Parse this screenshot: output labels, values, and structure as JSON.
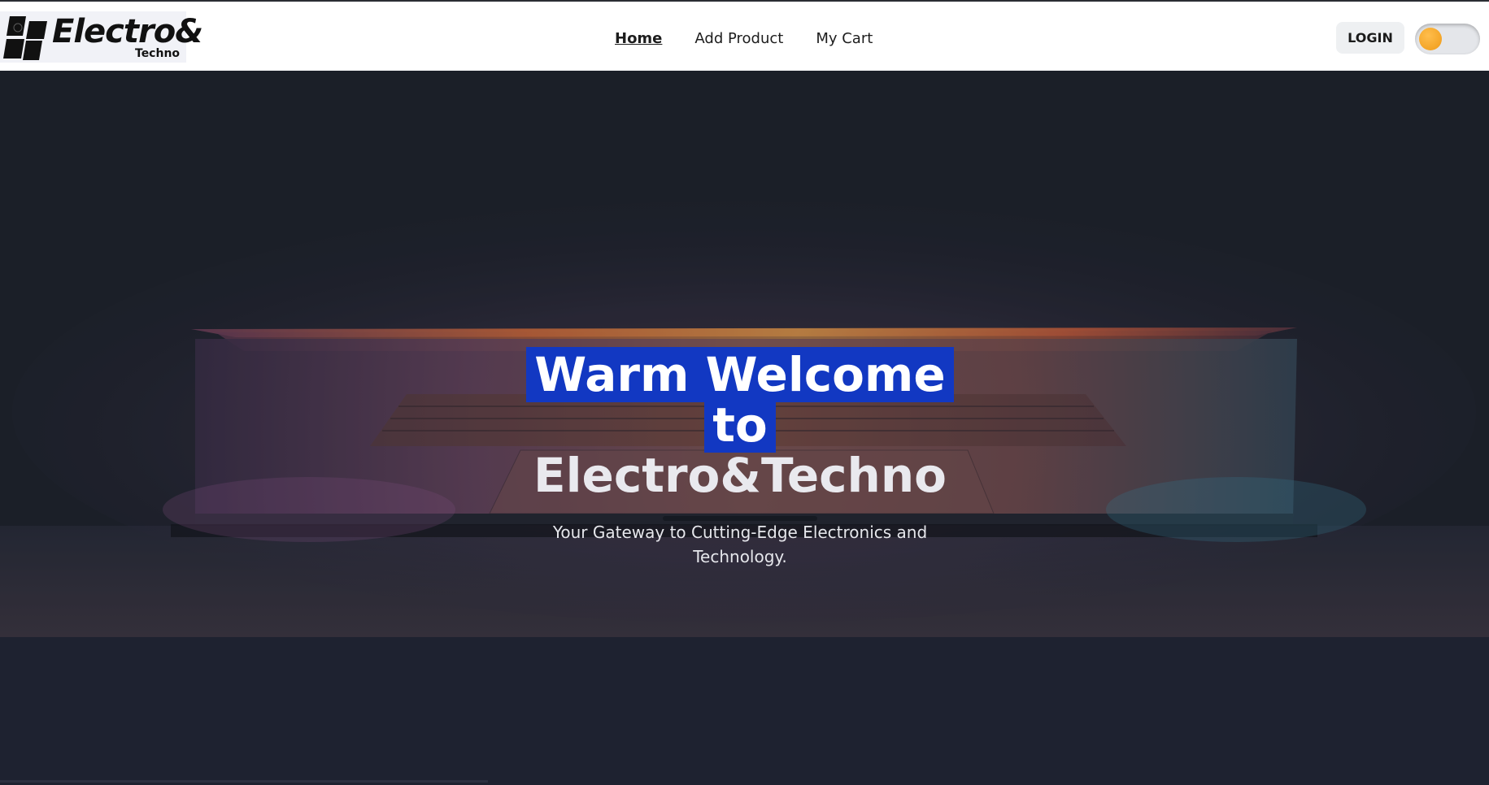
{
  "brand": {
    "logo_name": "Electro&",
    "logo_sub": "Techno"
  },
  "nav": {
    "links": [
      {
        "label": "Home",
        "active": true
      },
      {
        "label": "Add Product",
        "active": false
      },
      {
        "label": "My Cart",
        "active": false
      }
    ],
    "login_label": "LOGIN",
    "theme_toggle": {
      "state": "off",
      "knob_color": "#f0a026"
    }
  },
  "hero": {
    "title_line1": "Warm Welcome",
    "title_line2": "to",
    "title_line3": "Electro&Techno",
    "subtitle": "Your Gateway to Cutting-Edge Electronics and Technology.",
    "selection_color": "#1238c2"
  },
  "icons": {
    "logo_mark": "logo-icon",
    "toggle": "theme-toggle-icon"
  }
}
